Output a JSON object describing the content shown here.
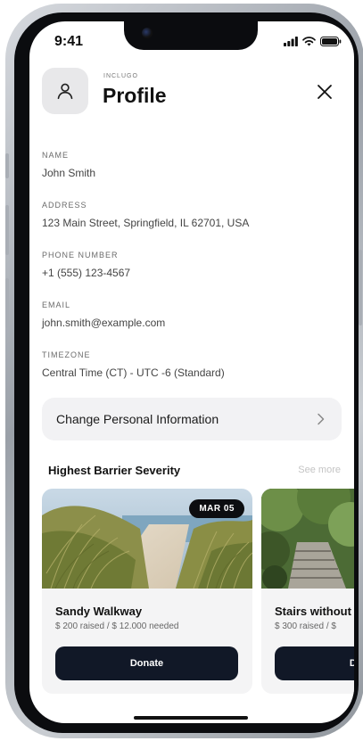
{
  "status": {
    "time": "9:41"
  },
  "header": {
    "brand": "INCLUGO",
    "title": "Profile"
  },
  "fields": [
    {
      "label": "NAME",
      "value": "John Smith"
    },
    {
      "label": "ADDRESS",
      "value": "123 Main Street, Springfield, IL 62701, USA"
    },
    {
      "label": "PHONE NUMBER",
      "value": "+1 (555) 123-4567"
    },
    {
      "label": "EMAIL",
      "value": "john.smith@example.com"
    },
    {
      "label": "TIMEZONE",
      "value": "Central Time (CT) - UTC -6 (Standard)"
    }
  ],
  "change_info": {
    "label": "Change Personal Information"
  },
  "section": {
    "title": "Highest Barrier Severity",
    "see_more": "See more"
  },
  "cards": [
    {
      "date": "MAR 05",
      "title": "Sandy Walkway",
      "funding": "$ 200 raised / $ 12.000 needed",
      "button": "Donate"
    },
    {
      "title": "Stairs without",
      "funding": "$ 300 raised / $",
      "button": "Donate"
    }
  ],
  "colors": {
    "primary": "#111827",
    "card_bg": "#f4f4f5",
    "muted": "#6b6b6b"
  },
  "icons": {
    "avatar": "user-icon",
    "close": "close-icon",
    "chevron": "chevron-right-icon"
  }
}
